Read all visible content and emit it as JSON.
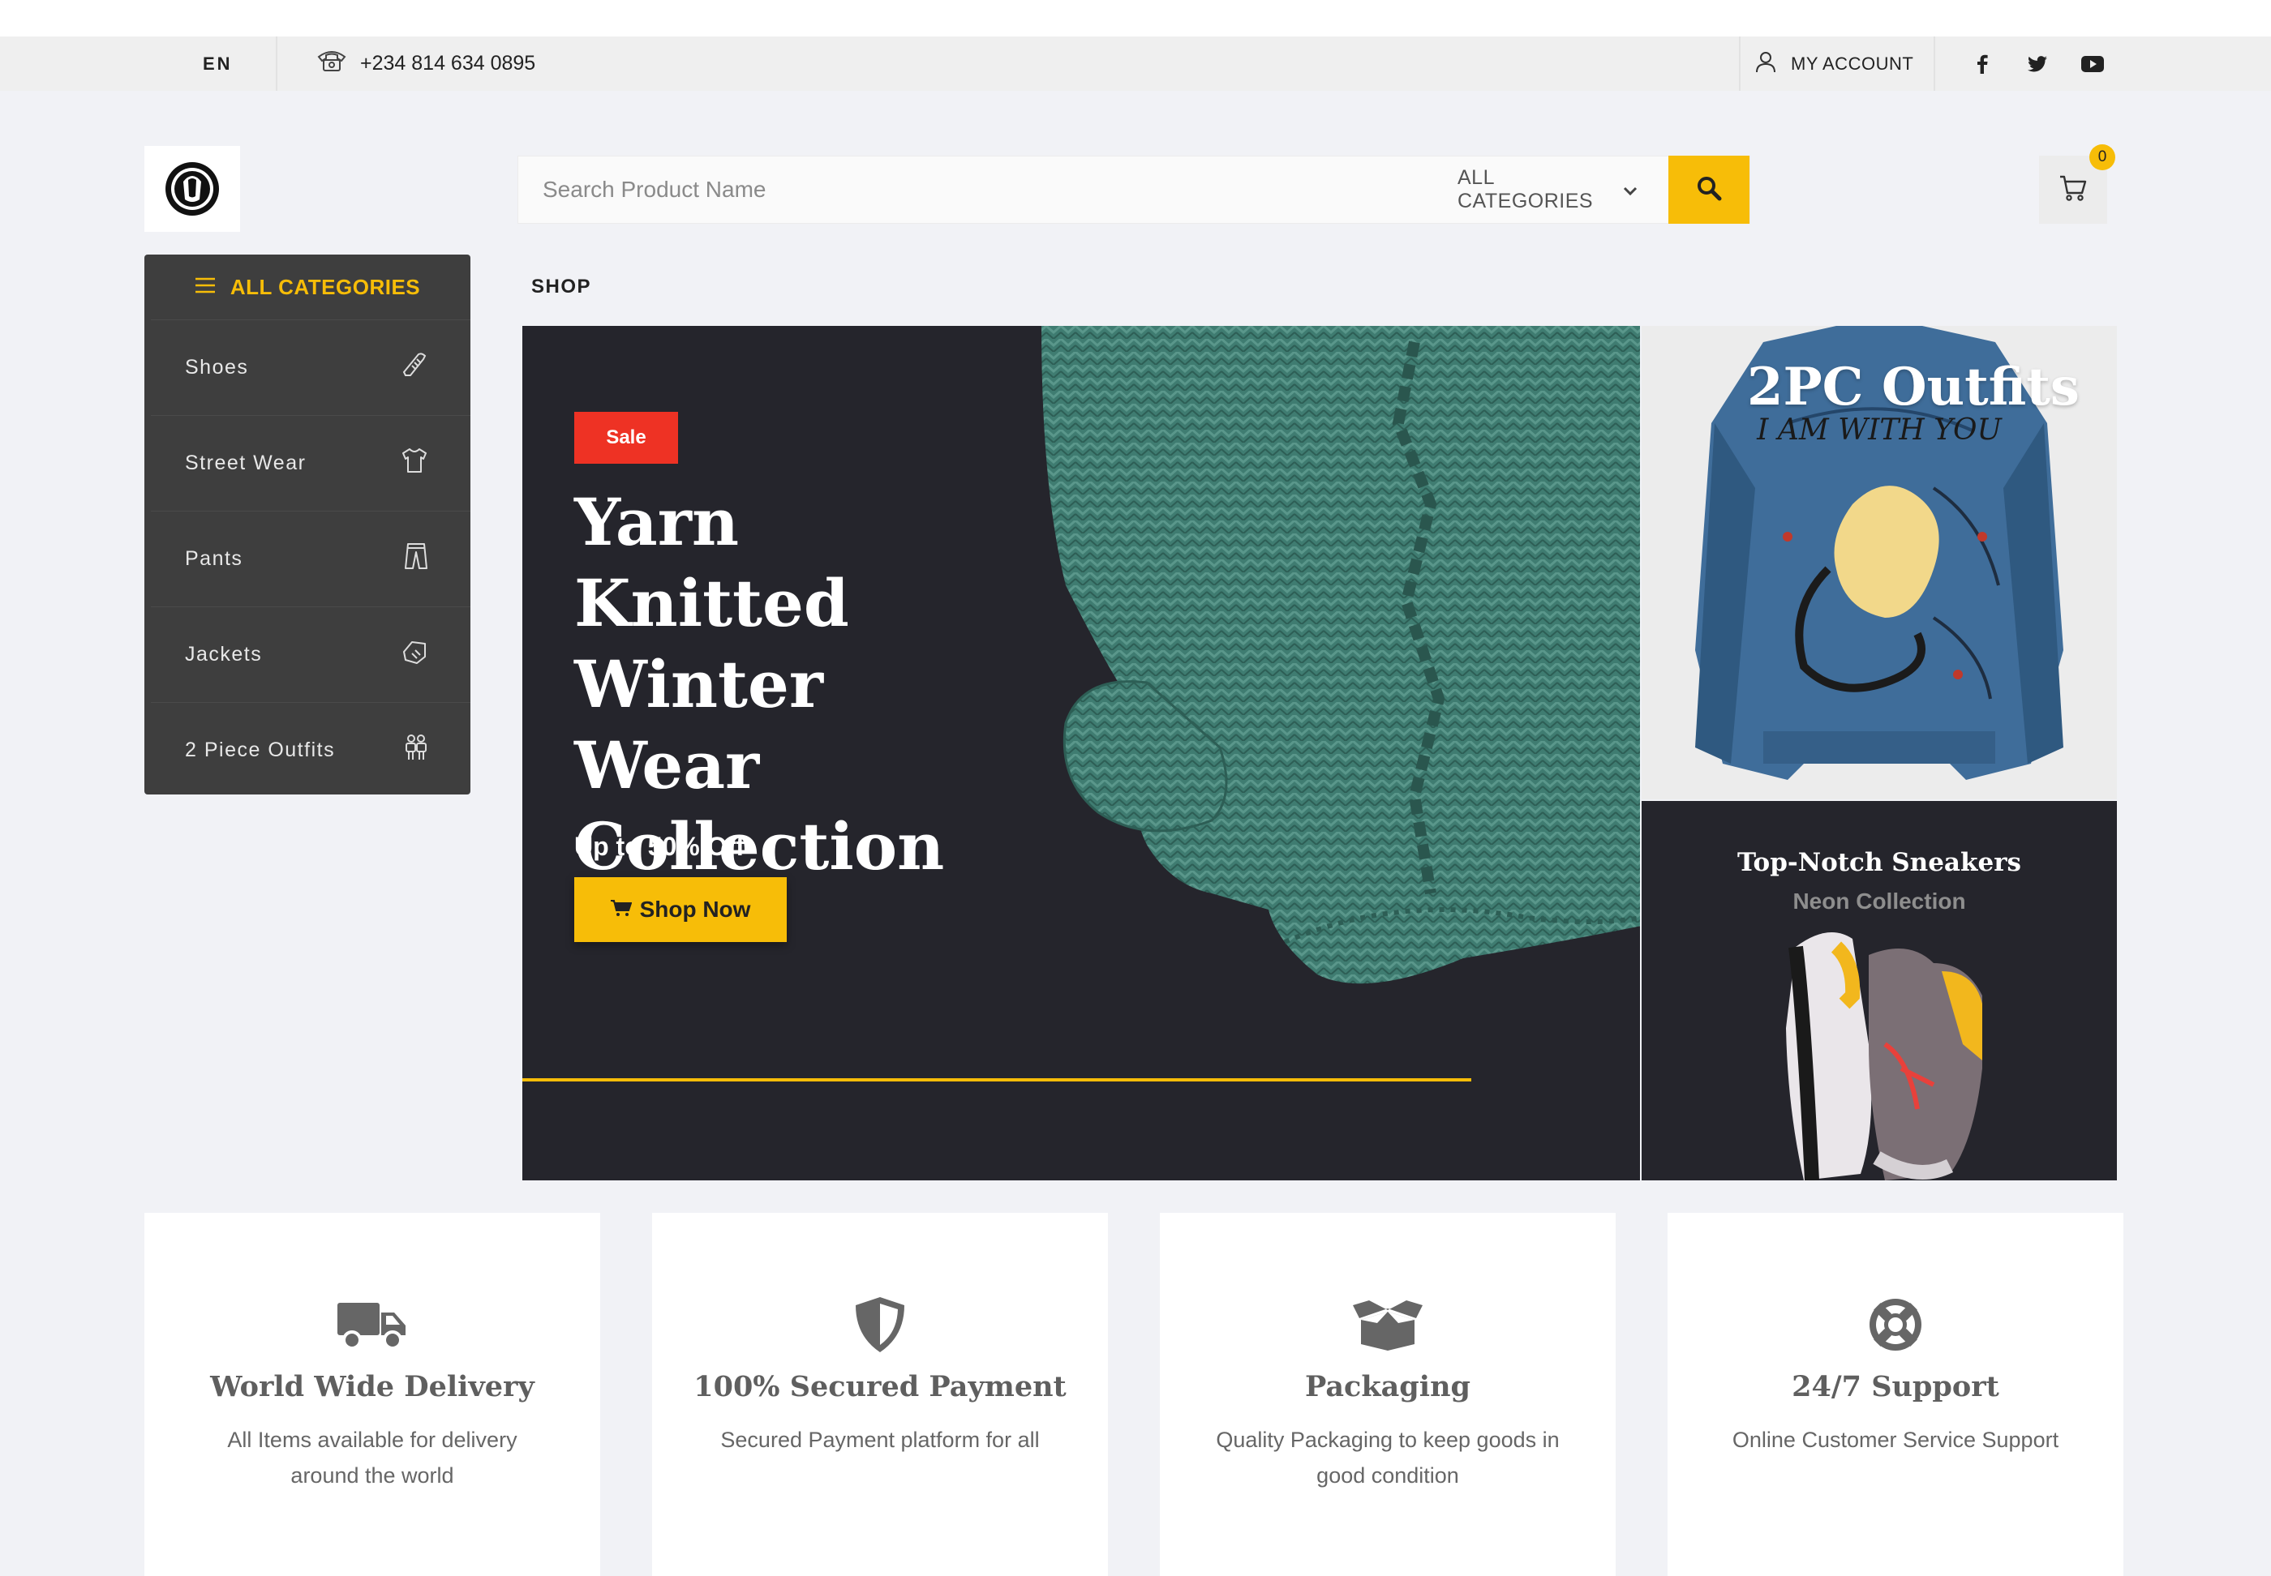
{
  "topbar": {
    "language": "EN",
    "phone": "+234 814 634 0895",
    "account_label": "MY ACCOUNT",
    "socials": [
      "facebook-icon",
      "twitter-icon",
      "youtube-icon"
    ]
  },
  "header": {
    "search_placeholder": "Search Product Name",
    "category_selected": "ALL CATEGORIES",
    "cart_count": "0"
  },
  "sidebar": {
    "title": "ALL CATEGORIES",
    "items": [
      {
        "label": "Shoes",
        "icon": "shoe-icon"
      },
      {
        "label": "Street Wear",
        "icon": "tshirt-icon"
      },
      {
        "label": "Pants",
        "icon": "pants-icon"
      },
      {
        "label": "Jackets",
        "icon": "jacket-icon"
      },
      {
        "label": "2 Piece Outfits",
        "icon": "outfit-icon"
      }
    ]
  },
  "breadcrumb": "SHOP",
  "hero": {
    "badge": "Sale",
    "title_lines": [
      "Yarn Knitted",
      "Winter Wear",
      "Collection"
    ],
    "offer": "Up to 50% Off",
    "button": "Shop Now"
  },
  "promo_top": {
    "caption": "2PC Outfits"
  },
  "promo_bottom": {
    "title": "Top-Notch Sneakers",
    "subtitle": "Neon Collection"
  },
  "features": [
    {
      "title": "World Wide Delivery",
      "desc": "All Items available for delivery around the world",
      "icon": "truck-icon"
    },
    {
      "title": "100% Secured Payment",
      "desc": "Secured Payment platform for all",
      "icon": "shield-icon"
    },
    {
      "title": "Packaging",
      "desc": "Quality Packaging to keep goods in good condition",
      "icon": "box-icon"
    },
    {
      "title": "24/7 Support",
      "desc": "Online Customer Service Support",
      "icon": "lifebuoy-icon"
    }
  ],
  "colors": {
    "accent": "#f7bd08",
    "dark": "#25252c",
    "sale": "#ee3224",
    "sidebar": "#3e3e3e"
  }
}
